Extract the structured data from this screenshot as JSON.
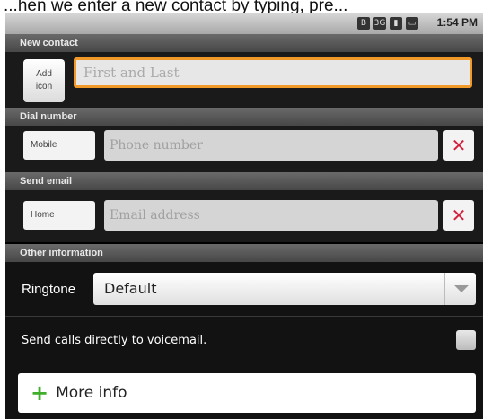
{
  "top_caption": "...hen we enter a new contact by typing, pre...",
  "status_bar": {
    "time": "1:54 PM",
    "icons": [
      "bluetooth-icon",
      "data-icon",
      "signal-icon",
      "battery-icon"
    ]
  },
  "new_contact": {
    "header": "New contact",
    "add_icon_label_line1": "Add",
    "add_icon_label_line2": "icon",
    "name_placeholder": "First and Last"
  },
  "dial_number": {
    "header": "Dial number",
    "type_label": "Mobile",
    "placeholder": "Phone number",
    "remove_symbol": "✕"
  },
  "send_email": {
    "header": "Send email",
    "type_label": "Home",
    "placeholder": "Email address",
    "remove_symbol": "✕"
  },
  "other_info": {
    "header": "Other information",
    "ringtone_label": "Ringtone",
    "ringtone_value": "Default",
    "voicemail_label": "Send calls directly to voicemail.",
    "voicemail_checked": false
  },
  "more_info": {
    "plus": "+",
    "label": "More info"
  },
  "colors": {
    "focus_orange": "#f19a2a",
    "remove_red": "#d21e3a",
    "plus_green": "#3fae2a"
  }
}
